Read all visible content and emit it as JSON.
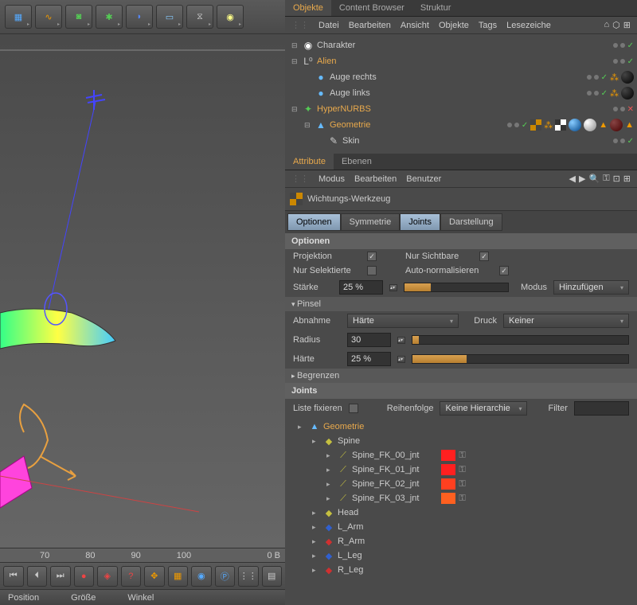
{
  "toolbar": {
    "tools": [
      "cube-icon",
      "spline-icon",
      "nurbs-icon",
      "array-icon",
      "deformer-icon",
      "floor-icon",
      "camera-icon",
      "light-icon"
    ]
  },
  "ruler": {
    "marks": [
      "70",
      "80",
      "90",
      "100"
    ],
    "frame_label": "0 B"
  },
  "timeline": {
    "buttons": [
      "first",
      "prev",
      "last",
      "record",
      "key",
      "auto",
      "move",
      "param",
      "select",
      "play",
      "keys",
      "misc"
    ]
  },
  "status_bar": {
    "pos": "Position",
    "size": "Größe",
    "angle": "Winkel"
  },
  "tabs_top": {
    "items": [
      "Objekte",
      "Content Browser",
      "Struktur"
    ],
    "active": 0
  },
  "obj_menu": {
    "items": [
      "Datei",
      "Bearbeiten",
      "Ansicht",
      "Objekte",
      "Tags",
      "Lesezeiche"
    ]
  },
  "obj_tree": [
    {
      "depth": 0,
      "exp": "⊟",
      "icon": "◉",
      "icon_color": "#fff",
      "label": "Charakter",
      "tags": "basic"
    },
    {
      "depth": 0,
      "exp": "⊟",
      "icon": "L⁰",
      "icon_color": "#ccc",
      "label": "Alien",
      "active": true,
      "tags": "basic"
    },
    {
      "depth": 1,
      "exp": "",
      "icon": "●",
      "icon_color": "#6bf",
      "label": "Auge rechts",
      "tags": "sphere"
    },
    {
      "depth": 1,
      "exp": "",
      "icon": "●",
      "icon_color": "#6bf",
      "label": "Auge links",
      "tags": "sphere"
    },
    {
      "depth": 0,
      "exp": "⊟",
      "icon": "✦",
      "icon_color": "#5c5",
      "label": "HyperNURBS",
      "active": true,
      "tags": "cross"
    },
    {
      "depth": 1,
      "exp": "⊟",
      "icon": "▲",
      "icon_color": "#6bf",
      "label": "Geometrie",
      "active": true,
      "tags": "many"
    },
    {
      "depth": 2,
      "exp": "",
      "icon": "✎",
      "icon_color": "#ccc",
      "label": "Skin",
      "tags": "basic"
    }
  ],
  "tabs_attr": {
    "items": [
      "Attribute",
      "Ebenen"
    ],
    "active": 0
  },
  "attr_menu": {
    "items": [
      "Modus",
      "Bearbeiten",
      "Benutzer"
    ]
  },
  "attr_title": "Wichtungs-Werkzeug",
  "sub_tabs": {
    "items": [
      "Optionen",
      "Symmetrie",
      "Joints",
      "Darstellung"
    ],
    "active": [
      0,
      2
    ]
  },
  "sections": {
    "options_head": "Optionen",
    "projection": "Projektion",
    "visible_only": "Nur Sichtbare",
    "selected_only": "Nur Selektierte",
    "auto_norm": "Auto-normalisieren",
    "strength": "Stärke",
    "strength_val": "25 %",
    "mode": "Modus",
    "mode_val": "Hinzufügen",
    "brush_head": "Pinsel",
    "falloff": "Abnahme",
    "falloff_val": "Härte",
    "pressure": "Druck",
    "pressure_val": "Keiner",
    "radius": "Radius",
    "radius_val": "30",
    "hardness": "Härte",
    "hardness_val": "25 %",
    "limit_head": "Begrenzen",
    "joints_head": "Joints",
    "fix_list": "Liste fixieren",
    "order": "Reihenfolge",
    "order_val": "Keine Hierarchie",
    "filter": "Filter"
  },
  "joints_tree": [
    {
      "depth": 0,
      "icon": "▲",
      "icon_color": "#6bf",
      "label": "Geometrie",
      "active": true
    },
    {
      "depth": 1,
      "icon": "◆",
      "icon_color": "#c5c040",
      "label": "Spine"
    },
    {
      "depth": 2,
      "icon": "⟋",
      "icon_color": "#c5c040",
      "label": "Spine_FK_00_jnt",
      "color": "#ff2020"
    },
    {
      "depth": 2,
      "icon": "⟋",
      "icon_color": "#c5c040",
      "label": "Spine_FK_01_jnt",
      "color": "#ff2020"
    },
    {
      "depth": 2,
      "icon": "⟋",
      "icon_color": "#c5c040",
      "label": "Spine_FK_02_jnt",
      "color": "#ff4020"
    },
    {
      "depth": 2,
      "icon": "⟋",
      "icon_color": "#c5c040",
      "label": "Spine_FK_03_jnt",
      "color": "#ff6020"
    },
    {
      "depth": 1,
      "icon": "◆",
      "icon_color": "#c5c040",
      "label": "Head"
    },
    {
      "depth": 1,
      "icon": "◆",
      "icon_color": "#3060d0",
      "label": "L_Arm"
    },
    {
      "depth": 1,
      "icon": "◆",
      "icon_color": "#d03030",
      "label": "R_Arm"
    },
    {
      "depth": 1,
      "icon": "◆",
      "icon_color": "#3060d0",
      "label": "L_Leg"
    },
    {
      "depth": 1,
      "icon": "◆",
      "icon_color": "#d03030",
      "label": "R_Leg"
    }
  ]
}
